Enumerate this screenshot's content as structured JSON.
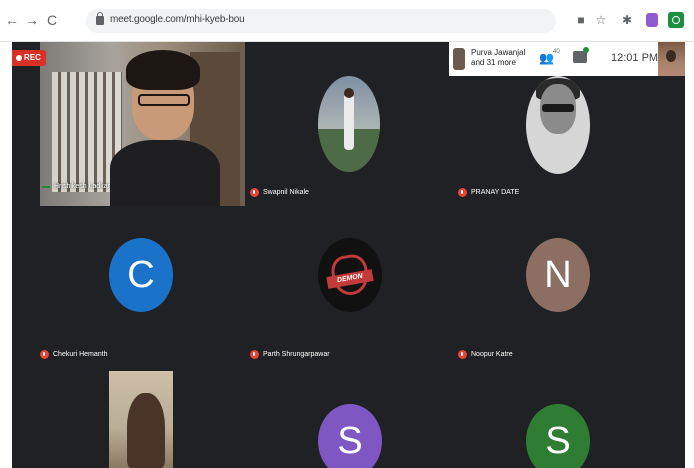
{
  "browser": {
    "url": "meet.google.com/mhi-kyeb-bou",
    "back_icon": "←",
    "forward_icon": "→",
    "reload_icon": "C"
  },
  "meeting": {
    "recording_label": "REC",
    "pinned_name": "Purva Jawanjal and 31 more",
    "people_count": "40",
    "time": "12:01 PM"
  },
  "participants": [
    {
      "name": "Hrishikesh Ladkar",
      "type": "video"
    },
    {
      "name": "Swapnil Nikale",
      "type": "photo-avatar"
    },
    {
      "name": "PRANAY DATE",
      "type": "photo-avatar"
    },
    {
      "name": "Chekuri Hemanth",
      "type": "letter-avatar",
      "initial": "C",
      "color": "#1a73c9"
    },
    {
      "name": "Parth Shrungarpawar",
      "type": "logo-avatar",
      "logo_text": "DEMON"
    },
    {
      "name": "Noopur Katre",
      "type": "letter-avatar",
      "initial": "N",
      "color": "#8d6e63"
    },
    {
      "name": "",
      "type": "video"
    },
    {
      "name": "",
      "type": "letter-avatar",
      "initial": "S",
      "color": "#7e57c2"
    },
    {
      "name": "",
      "type": "letter-avatar",
      "initial": "S",
      "color": "#2e7d32"
    }
  ],
  "colors": {
    "stage_background": "#202124",
    "mic_off": "#ea4335",
    "rec": "#d93025"
  }
}
